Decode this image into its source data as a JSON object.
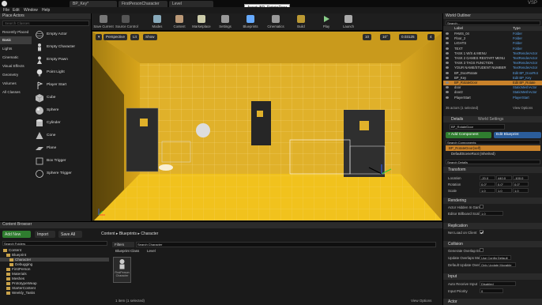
{
  "tabs": [
    "BP_Key*",
    "FirstPersonCharacter",
    "Level",
    "Asset: BP_RotateDoor"
  ],
  "tooltip": "Asset: BP_RotateDoor",
  "watermark": "VSP",
  "menu": [
    "File",
    "Edit",
    "Window",
    "Help"
  ],
  "toolbar": [
    {
      "label": "Save Current",
      "color": "#777"
    },
    {
      "label": "Source Control",
      "color": "#555"
    },
    {
      "label": "Modes",
      "color": "#8ab"
    },
    {
      "label": "Content",
      "color": "#b97"
    },
    {
      "label": "Marketplace",
      "color": "#cca"
    },
    {
      "label": "Settings",
      "color": "#999"
    },
    {
      "label": "Blueprints",
      "color": "#6af"
    },
    {
      "label": "Cinematics",
      "color": "#999"
    },
    {
      "label": "Build",
      "color": "#b93"
    },
    {
      "label": "Play",
      "color": "#8c8"
    },
    {
      "label": "Launch",
      "color": "#aaa"
    }
  ],
  "place_actors": {
    "title": "Place Actors",
    "search_placeholder": "Search Classes",
    "categories": [
      "Recently Placed",
      "Basic",
      "Lights",
      "Cinematic",
      "Visual Effects",
      "Geometry",
      "Volumes",
      "All Classes"
    ],
    "active_category": "Basic",
    "actors": [
      {
        "name": "Empty Actor",
        "icon": "sphere-wire-icon"
      },
      {
        "name": "Empty Character",
        "icon": "character-icon"
      },
      {
        "name": "Empty Pawn",
        "icon": "pawn-icon"
      },
      {
        "name": "Point Light",
        "icon": "bulb-icon"
      },
      {
        "name": "Player Start",
        "icon": "player-start-icon"
      },
      {
        "name": "Cube",
        "icon": "cube-icon"
      },
      {
        "name": "Sphere",
        "icon": "sphere-icon"
      },
      {
        "name": "Cylinder",
        "icon": "cylinder-icon"
      },
      {
        "name": "Cone",
        "icon": "cone-icon"
      },
      {
        "name": "Plane",
        "icon": "plane-icon"
      },
      {
        "name": "Box Trigger",
        "icon": "box-trigger-icon"
      },
      {
        "name": "Sphere Trigger",
        "icon": "sphere-trigger-icon"
      }
    ]
  },
  "viewport": {
    "buttons": [
      "Perspective",
      "Lit",
      "Show"
    ],
    "right_values": [
      "10",
      "10°",
      "0.03125",
      "4"
    ]
  },
  "world_outliner": {
    "title": "World Outliner",
    "search_placeholder": "Search...",
    "col_label": "Label",
    "col_type": "Type",
    "rows": [
      {
        "label": "PAWS_04",
        "type": "Folder"
      },
      {
        "label": "Floor_2",
        "type": "Folder"
      },
      {
        "label": "LIGHTS",
        "type": "Folder"
      },
      {
        "label": "TEXT",
        "type": "Folder"
      },
      {
        "label": "TASK 1 W/S & MENU",
        "type": "TextRenderActor"
      },
      {
        "label": "TASK 2 GAMES RESTART MENU",
        "type": "TextRenderActor"
      },
      {
        "label": "TASK 3 TAGS FUNCTION",
        "type": "TextRenderActor"
      },
      {
        "label": "YOUR NAME/STUDENT NUMBER",
        "type": "TextRenderActor"
      },
      {
        "label": "BP_DoorRotate",
        "type": "Edit BP_DoorRot"
      },
      {
        "label": "BP_Key",
        "type": "Edit BP_Key"
      },
      {
        "label": "BP_RotateDoor",
        "type": "Edit BP_Rotate"
      },
      {
        "label": "door",
        "type": "StaticMeshActor"
      },
      {
        "label": "door2",
        "type": "StaticMeshActor"
      },
      {
        "label": "PlayerStart",
        "type": "PlayerStart"
      }
    ],
    "selected_index": 10,
    "status": "35 actors (1 selected)",
    "view_options": "View Options"
  },
  "details": {
    "tabs": [
      "Details",
      "World Settings"
    ],
    "object_name": "BP_RotateDoor",
    "add_component": "+ Add Component",
    "edit_blueprint": "Edit Blueprint",
    "search_components": "Search Components",
    "components": [
      "BP_RotateDoor(self)",
      "DefaultSceneRoot (Inherited)"
    ],
    "search_details": "Search Details",
    "sections": {
      "transform": "Transform",
      "rendering": "Rendering",
      "replication": "Replication",
      "collision": "Collision",
      "input": "Input",
      "actor": "Actor"
    },
    "transform": {
      "location_label": "Location",
      "location": [
        "-20.0",
        "440.0",
        "-100.0"
      ],
      "rotation_label": "Rotation",
      "rotation": [
        "0.0°",
        "0.0°",
        "0.0°"
      ],
      "scale_label": "Scale",
      "scale": [
        "1.0",
        "1.0",
        "1.0"
      ]
    },
    "rendering": {
      "hidden_label": "Actor Hidden In Game",
      "billboard_label": "Editor Billboard Scal",
      "billboard_value": "1.0"
    },
    "replication": {
      "net_load_label": "Net Load on Client"
    },
    "collision": {
      "overlap_label": "Generate Overlap Ev",
      "update_label": "Update Overlaps Me",
      "update_value": "Use Config Default",
      "default_label": "Default Update Over",
      "default_value": "Only Update Movable"
    },
    "input": {
      "receive_label": "Auto Receive Input",
      "receive_value": "Disabled",
      "priority_label": "Input Priority",
      "priority_value": "0"
    }
  },
  "content_browser": {
    "title": "Content Browser",
    "add_new": "Add New",
    "import": "Import",
    "save_all": "Save All",
    "breadcrumb": [
      "Content",
      "Blueprints",
      "Character"
    ],
    "search_folders": "Search Folders",
    "tree": [
      "Content",
      "Blueprint",
      "Character",
      "Debugging",
      "FirstPerson",
      "Materials",
      "Meshes",
      "PrototypeWeap",
      "StarterContent",
      "Weekly_Tasks"
    ],
    "filters": "Filters",
    "search_asset": "Search Character",
    "asset_class": "Blueprint Class",
    "level": "Level",
    "asset_name": "FirstPerson Character",
    "count": "1 item (1 selected)",
    "view_options": "View Options"
  }
}
